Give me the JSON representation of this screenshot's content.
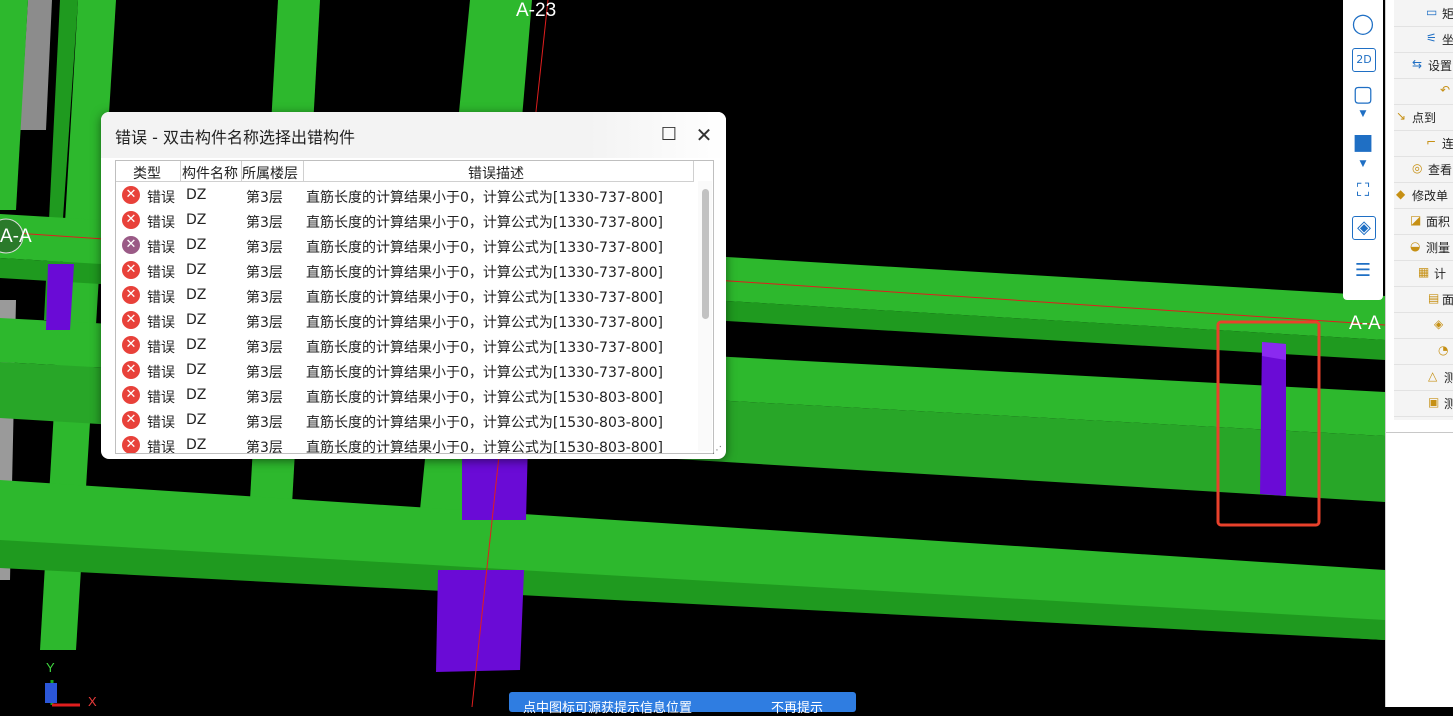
{
  "viewport": {
    "axis_labels": {
      "top": "A-23",
      "left": "A-A",
      "right": "A-A"
    },
    "coord_axes": {
      "y": "Y",
      "x": "X"
    }
  },
  "dialog": {
    "title": "错误 - 双击构件名称选择出错构件",
    "maximize_icon": "☐",
    "close_icon": "✕",
    "columns": [
      "类型",
      "构件名称",
      "所属楼层",
      "错误描述"
    ],
    "rows": [
      {
        "type": "错误",
        "name": "DZ",
        "floor": "第3层",
        "desc": "直筋长度的计算结果小于0，计算公式为[1330-737-800]",
        "selected": false
      },
      {
        "type": "错误",
        "name": "DZ",
        "floor": "第3层",
        "desc": "直筋长度的计算结果小于0，计算公式为[1330-737-800]",
        "selected": false
      },
      {
        "type": "错误",
        "name": "DZ",
        "floor": "第3层",
        "desc": "直筋长度的计算结果小于0，计算公式为[1330-737-800]",
        "selected": true
      },
      {
        "type": "错误",
        "name": "DZ",
        "floor": "第3层",
        "desc": "直筋长度的计算结果小于0，计算公式为[1330-737-800]",
        "selected": false
      },
      {
        "type": "错误",
        "name": "DZ",
        "floor": "第3层",
        "desc": "直筋长度的计算结果小于0，计算公式为[1330-737-800]",
        "selected": false
      },
      {
        "type": "错误",
        "name": "DZ",
        "floor": "第3层",
        "desc": "直筋长度的计算结果小于0，计算公式为[1330-737-800]",
        "selected": false
      },
      {
        "type": "错误",
        "name": "DZ",
        "floor": "第3层",
        "desc": "直筋长度的计算结果小于0，计算公式为[1330-737-800]",
        "selected": false
      },
      {
        "type": "错误",
        "name": "DZ",
        "floor": "第3层",
        "desc": "直筋长度的计算结果小于0，计算公式为[1330-737-800]",
        "selected": false
      },
      {
        "type": "错误",
        "name": "DZ",
        "floor": "第3层",
        "desc": "直筋长度的计算结果小于0，计算公式为[1530-803-800]",
        "selected": false
      },
      {
        "type": "错误",
        "name": "DZ",
        "floor": "第3层",
        "desc": "直筋长度的计算结果小于0，计算公式为[1530-803-800]",
        "selected": false
      },
      {
        "type": "错误",
        "name": "DZ",
        "floor": "第3层",
        "desc": "直筋长度的计算结果小于0，计算公式为[1530-803-800]",
        "selected": false
      }
    ]
  },
  "view_toolbar": {
    "buttons": [
      {
        "name": "orbit-icon",
        "glyph": "◯"
      },
      {
        "name": "view-2d-icon",
        "glyph": "2D"
      },
      {
        "name": "cube-view-icon",
        "glyph": "▢"
      },
      {
        "name": "solid-cube-icon",
        "glyph": "■"
      },
      {
        "name": "fullscreen-icon",
        "glyph": "⛶"
      },
      {
        "name": "isolate-view-icon",
        "glyph": "◈"
      },
      {
        "name": "display-settings-icon",
        "glyph": "☰"
      }
    ]
  },
  "command_panel": {
    "items": [
      {
        "icon": "▭",
        "label": "矩"
      },
      {
        "icon": "⚟",
        "label": "坐"
      },
      {
        "icon": "⇆",
        "label": "设置"
      },
      {
        "icon": "↶",
        "label": ""
      },
      {
        "icon": "↘",
        "label": "点到"
      },
      {
        "icon": "⌐",
        "label": "连"
      },
      {
        "icon": "◎",
        "label": "查看"
      },
      {
        "icon": "◆",
        "label": "修改单"
      },
      {
        "icon": "◪",
        "label": "面积"
      },
      {
        "icon": "◒",
        "label": "测量"
      },
      {
        "icon": "▦",
        "label": "计"
      },
      {
        "icon": "▤",
        "label": "面"
      },
      {
        "icon": "◈",
        "label": ""
      },
      {
        "icon": "◔",
        "label": ""
      },
      {
        "icon": "△",
        "label": "测"
      },
      {
        "icon": "▣",
        "label": "测"
      }
    ]
  },
  "notification": {
    "message": "点中图标可源获提示信息位置",
    "link": "不再提示"
  },
  "colors": {
    "beam_green": "#2db82d",
    "beam_green_dark": "#1f9a1f",
    "column_purple": "#6a0bd6",
    "highlight_red": "#e8412b",
    "error_icon": "#e8413a",
    "accent_blue": "#2f7de1"
  }
}
